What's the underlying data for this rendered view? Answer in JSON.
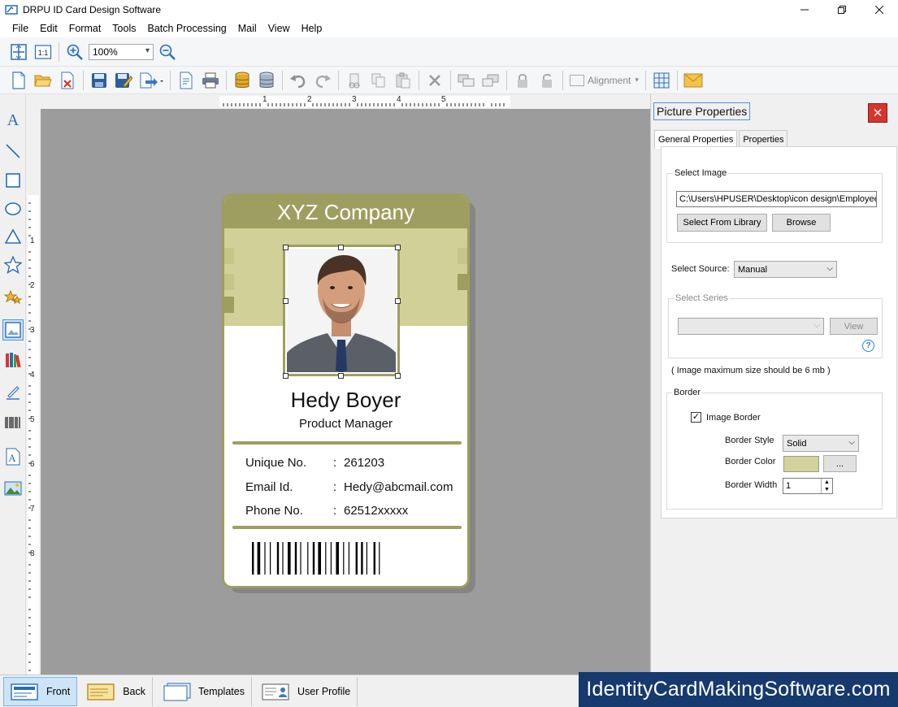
{
  "window": {
    "title": "DRPU ID Card Design Software"
  },
  "menu": [
    "File",
    "Edit",
    "Format",
    "Tools",
    "Batch Processing",
    "Mail",
    "View",
    "Help"
  ],
  "toolbar": {
    "zoom_value": "100%",
    "one_to_one": "1:1",
    "alignment_label": "Alignment"
  },
  "ruler": {
    "horizontal": [
      "1",
      "2",
      "3",
      "4",
      "5"
    ],
    "vertical": [
      "1",
      "2",
      "3",
      "4",
      "5",
      "6",
      "7",
      "8"
    ]
  },
  "card": {
    "company": "XYZ Company",
    "name": "Hedy Boyer",
    "role": "Product Manager",
    "fields": [
      {
        "label": "Unique No.",
        "colon": ":",
        "value": "261203"
      },
      {
        "label": "Email Id.",
        "colon": ":",
        "value": "Hedy@abcmail.com"
      },
      {
        "label": "Phone No.",
        "colon": ":",
        "value": "62512xxxxx"
      }
    ],
    "accent_color": "#9e9e60",
    "band_color": "#d0d098"
  },
  "panel": {
    "title": "Picture Properties",
    "close_label": "✕",
    "tabs": [
      "General Properties",
      "Properties"
    ],
    "select_image_group": "Select Image",
    "image_path": "C:\\Users\\HPUSER\\Desktop\\icon design\\Employee",
    "select_from_library": "Select From Library",
    "browse": "Browse",
    "select_source_label": "Select Source:",
    "select_source_value": "Manual",
    "select_series_group": "Select Series",
    "view_button": "View",
    "help_label": "?",
    "size_note": "( Image maximum size should be 6 mb )",
    "border_group": "Border",
    "image_border_label": "Image Border",
    "image_border_checked": true,
    "border_style_label": "Border Style",
    "border_style_value": "Solid",
    "border_color_label": "Border Color",
    "border_color_value": "#d2d29a",
    "border_color_button": "...",
    "border_width_label": "Border Width",
    "border_width_value": "1"
  },
  "bottom_tabs": [
    {
      "label": "Front",
      "active": true
    },
    {
      "label": "Back",
      "active": false
    },
    {
      "label": "Templates",
      "active": false
    },
    {
      "label": "User Profile",
      "active": false
    }
  ],
  "brand_text": "IdentityCardMakingSoftware.com"
}
